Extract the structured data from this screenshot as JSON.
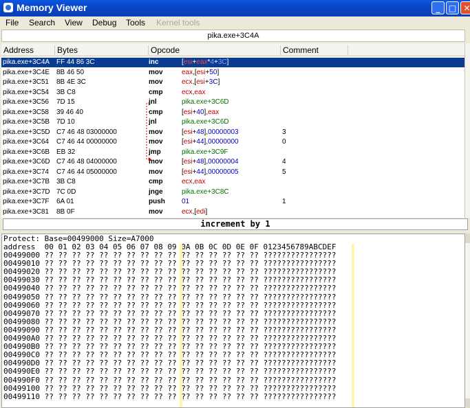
{
  "window": {
    "title": "Memory Viewer",
    "controls": {
      "minimize": "_",
      "maximize": "□",
      "close": "✕"
    }
  },
  "menu": {
    "file": "File",
    "search": "Search",
    "view": "View",
    "debug": "Debug",
    "tools": "Tools",
    "kernel_tools": "Kernel tools"
  },
  "disassembler": {
    "address_bar": "pika.exe+3C4A",
    "columns": {
      "address": "Address",
      "bytes": "Bytes",
      "opcode": "Opcode",
      "comment": "Comment"
    },
    "rows": [
      {
        "addr": "pika.exe+3C4A",
        "bytes": "FF 44 86 3C",
        "op": "inc",
        "args": "[esi+eax*4+3C]",
        "comment": ""
      },
      {
        "addr": "pika.exe+3C4E",
        "bytes": "8B 46 50",
        "op": "mov",
        "args": "eax,[esi+50]",
        "comment": ""
      },
      {
        "addr": "pika.exe+3C51",
        "bytes": "8B 4E 3C",
        "op": "mov",
        "args": "ecx,[esi+3C]",
        "comment": ""
      },
      {
        "addr": "pika.exe+3C54",
        "bytes": "3B C8",
        "op": "cmp",
        "args": "ecx,eax",
        "comment": ""
      },
      {
        "addr": "pika.exe+3C56",
        "bytes": "7D 15",
        "op": "jnl",
        "args": "pika.exe+3C6D",
        "comment": ""
      },
      {
        "addr": "pika.exe+3C58",
        "bytes": "39 46 40",
        "op": "cmp",
        "args": "[esi+40],eax",
        "comment": ""
      },
      {
        "addr": "pika.exe+3C5B",
        "bytes": "7D 10",
        "op": "jnl",
        "args": "pika.exe+3C6D",
        "comment": ""
      },
      {
        "addr": "pika.exe+3C5D",
        "bytes": "C7 46 48 03000000",
        "op": "mov",
        "args": "[esi+48],00000003",
        "comment": "3"
      },
      {
        "addr": "pika.exe+3C64",
        "bytes": "C7 46 44 00000000",
        "op": "mov",
        "args": "[esi+44],00000000",
        "comment": "0"
      },
      {
        "addr": "pika.exe+3C6B",
        "bytes": "EB 32",
        "op": "jmp",
        "args": "pika.exe+3C9F",
        "comment": ""
      },
      {
        "addr": "pika.exe+3C6D",
        "bytes": "C7 46 48 04000000",
        "op": "mov",
        "args": "[esi+48],00000004",
        "comment": "4"
      },
      {
        "addr": "pika.exe+3C74",
        "bytes": "C7 46 44 05000000",
        "op": "mov",
        "args": "[esi+44],00000005",
        "comment": "5"
      },
      {
        "addr": "pika.exe+3C7B",
        "bytes": "3B C8",
        "op": "cmp",
        "args": "ecx,eax",
        "comment": ""
      },
      {
        "addr": "pika.exe+3C7D",
        "bytes": "7C 0D",
        "op": "jnge",
        "args": "pika.exe+3C8C",
        "comment": ""
      },
      {
        "addr": "pika.exe+3C7F",
        "bytes": "6A 01",
        "op": "push",
        "args": "01",
        "comment": "1"
      },
      {
        "addr": "pika.exe+3C81",
        "bytes": "8B 0F",
        "op": "mov",
        "args": "ecx,[edi]",
        "comment": ""
      }
    ]
  },
  "status": "increment by 1",
  "hexview": {
    "protect_line": "Protect: Base=00499000 Size=A7000",
    "header": "address  00 01 02 03 04 05 06 07 08 09 0A 0B 0C 0D 0E 0F 0123456789ABCDEF",
    "fill_bytes": "?? ?? ?? ?? ?? ?? ?? ?? ?? ?? ?? ?? ?? ?? ?? ??",
    "fill_ascii": "????????????????",
    "addresses": [
      "00499000",
      "00499010",
      "00499020",
      "00499030",
      "00499040",
      "00499050",
      "00499060",
      "00499070",
      "00499080",
      "00499090",
      "004990A0",
      "004990B0",
      "004990C0",
      "004990D0",
      "004990E0",
      "004990F0",
      "00499100",
      "00499110"
    ]
  }
}
